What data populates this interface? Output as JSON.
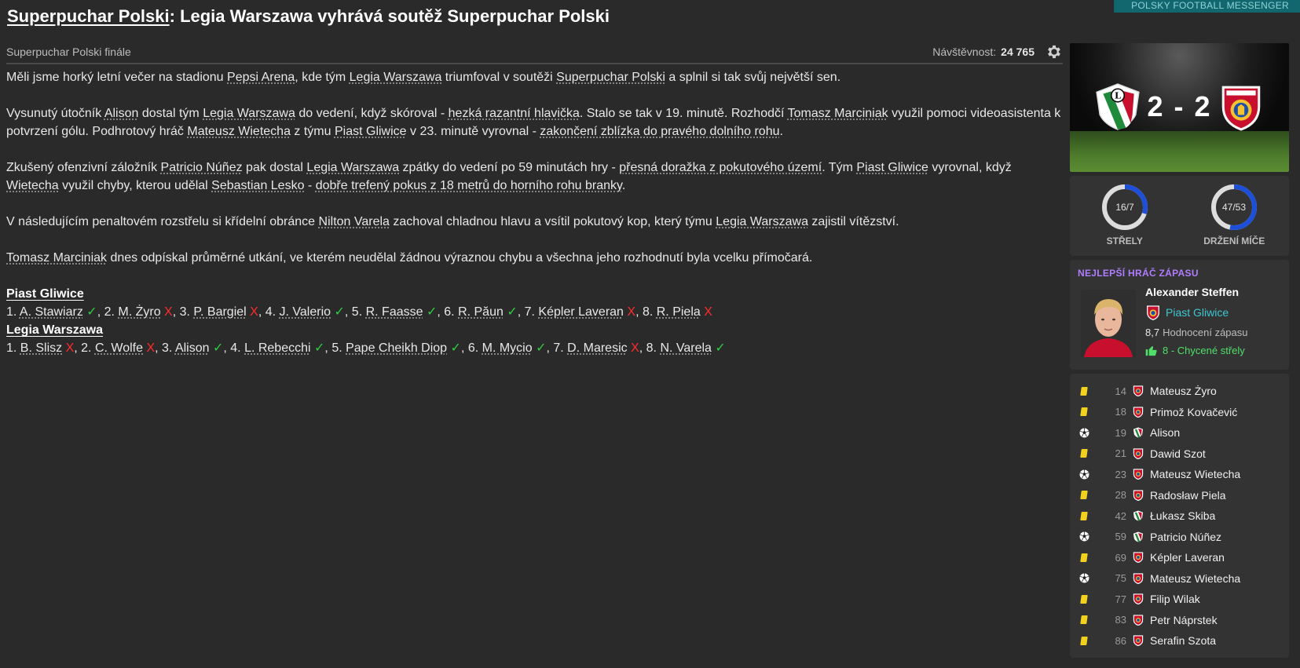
{
  "brand": "POLSKY FOOTBALL MESSENGER",
  "header": {
    "competition": "Superpuchar Polski",
    "headline": ": Legia Warszawa vyhrává soutěž Superpuchar Polski"
  },
  "subheader": {
    "stage": "Superpuchar Polski finále",
    "attendance_label": "Návštěvnost:",
    "attendance_value": "24 765"
  },
  "article": {
    "p1": [
      {
        "t": "Měli jsme horký letní večer na stadionu "
      },
      {
        "t": "Pepsi Arena",
        "u": true
      },
      {
        "t": ", kde tým "
      },
      {
        "t": "Legia Warszawa",
        "u": true
      },
      {
        "t": " triumfoval v soutěži "
      },
      {
        "t": "Superpuchar Polski",
        "u": true
      },
      {
        "t": " a splnil si tak svůj největší sen."
      }
    ],
    "p2": [
      {
        "t": "Vysunutý útočník "
      },
      {
        "t": "Alison",
        "u": true
      },
      {
        "t": " dostal tým "
      },
      {
        "t": "Legia Warszawa",
        "u": true
      },
      {
        "t": " do vedení, když skóroval - "
      },
      {
        "t": "hezká razantní hlavička",
        "u": true
      },
      {
        "t": ". Stalo se tak v 19. minutě. Rozhodčí "
      },
      {
        "t": "Tomasz Marciniak",
        "u": true
      },
      {
        "t": " využil pomoci videoasistenta k potvrzení gólu. Podhrotový hráč "
      },
      {
        "t": "Mateusz Wietecha",
        "u": true
      },
      {
        "t": " z týmu "
      },
      {
        "t": "Piast Gliwice",
        "u": true
      },
      {
        "t": " v 23. minutě vyrovnal - "
      },
      {
        "t": "zakončení zblízka do pravého dolního rohu",
        "u": true
      },
      {
        "t": "."
      }
    ],
    "p3": [
      {
        "t": "Zkušený ofenzivní záložník "
      },
      {
        "t": "Patricio Núñez",
        "u": true
      },
      {
        "t": " pak dostal "
      },
      {
        "t": "Legia Warszawa",
        "u": true
      },
      {
        "t": " zpátky do vedení po 59 minutách hry - "
      },
      {
        "t": "přesná doražka z pokutového území",
        "u": true
      },
      {
        "t": ". Tým "
      },
      {
        "t": "Piast Gliwice",
        "u": true
      },
      {
        "t": " vyrovnal, když "
      },
      {
        "t": "Wietecha",
        "u": true
      },
      {
        "t": " využil chyby, kterou udělal "
      },
      {
        "t": "Sebastian Lesko",
        "u": true
      },
      {
        "t": " - "
      },
      {
        "t": "dobře trefený pokus z 18 metrů do horního rohu branky",
        "u": true
      },
      {
        "t": "."
      }
    ],
    "p4": [
      {
        "t": "V následujícím penaltovém rozstřelu si křídelní obránce "
      },
      {
        "t": "Nilton Varela",
        "u": true
      },
      {
        "t": " zachoval chladnou hlavu a vsítil pokutový kop, který týmu "
      },
      {
        "t": "Legia Warszawa",
        "u": true
      },
      {
        "t": " zajistil vítězství."
      }
    ],
    "p5": [
      {
        "t": "Tomasz Marciniak",
        "u": true
      },
      {
        "t": " dnes odpískal průměrné utkání, ve kterém neudělal žádnou výraznou chybu a všechna jeho rozhodnutí byla vcelku přímočará."
      }
    ]
  },
  "penalties": [
    {
      "team": "Piast Gliwice",
      "kicks": [
        {
          "n": "1.",
          "name": "A. Stawiarz",
          "ok": true
        },
        {
          "n": "2.",
          "name": "M. Żyro",
          "ok": false
        },
        {
          "n": "3.",
          "name": "P. Bargiel",
          "ok": false
        },
        {
          "n": "4.",
          "name": "J. Valerio",
          "ok": true
        },
        {
          "n": "5.",
          "name": "R. Faasse",
          "ok": true
        },
        {
          "n": "6.",
          "name": "R. Păun",
          "ok": true
        },
        {
          "n": "7.",
          "name": "Képler Laveran",
          "ok": false
        },
        {
          "n": "8.",
          "name": "R. Piela",
          "ok": false
        }
      ]
    },
    {
      "team": "Legia Warszawa",
      "kicks": [
        {
          "n": "1.",
          "name": "B. Slisz",
          "ok": false
        },
        {
          "n": "2.",
          "name": "C. Wolfe",
          "ok": false
        },
        {
          "n": "3.",
          "name": "Alison",
          "ok": true
        },
        {
          "n": "4.",
          "name": "L. Rebecchi",
          "ok": true
        },
        {
          "n": "5.",
          "name": "Pape Cheikh Diop",
          "ok": true
        },
        {
          "n": "6.",
          "name": "M. Mycio",
          "ok": true
        },
        {
          "n": "7.",
          "name": "D. Maresic",
          "ok": false
        },
        {
          "n": "8.",
          "name": "N. Varela",
          "ok": true
        }
      ]
    }
  ],
  "marks": {
    "scored": "✓",
    "missed": "X"
  },
  "scorecard": {
    "score": "2 - 2"
  },
  "stats": [
    {
      "label": "STŘELY",
      "value": "16/7",
      "fraction": 0.3
    },
    {
      "label": "DRŽENÍ MÍČE",
      "value": "47/53",
      "fraction": 0.53
    }
  ],
  "colors": {
    "accent": "#1e4fd8",
    "ring_track": "#dddddd",
    "purple": "#b07dff",
    "teal": "#3ec7d0",
    "green": "#4fe06a"
  },
  "motm": {
    "heading": "NEJLEPŠÍ HRÁČ ZÁPASU",
    "name": "Alexander Steffen",
    "club": "Piast Gliwice",
    "rating_value": "8,7",
    "rating_label": "Hodnocení zápasu",
    "best_stat": "8 - Chycené střely"
  },
  "events": [
    {
      "icon": "yellow-card",
      "minute": "14",
      "team": "piast",
      "player": "Mateusz Żyro"
    },
    {
      "icon": "yellow-card",
      "minute": "18",
      "team": "piast",
      "player": "Primož Kovačević"
    },
    {
      "icon": "goal",
      "minute": "19",
      "team": "legia",
      "player": "Alison"
    },
    {
      "icon": "yellow-card",
      "minute": "21",
      "team": "piast",
      "player": "Dawid Szot"
    },
    {
      "icon": "goal",
      "minute": "23",
      "team": "piast",
      "player": "Mateusz Wietecha"
    },
    {
      "icon": "yellow-card",
      "minute": "28",
      "team": "piast",
      "player": "Radosław Piela"
    },
    {
      "icon": "yellow-card",
      "minute": "42",
      "team": "legia",
      "player": "Łukasz Skiba"
    },
    {
      "icon": "goal",
      "minute": "59",
      "team": "legia",
      "player": "Patricio Núñez"
    },
    {
      "icon": "yellow-card",
      "minute": "69",
      "team": "piast",
      "player": "Képler Laveran"
    },
    {
      "icon": "goal",
      "minute": "75",
      "team": "piast",
      "player": "Mateusz Wietecha"
    },
    {
      "icon": "yellow-card",
      "minute": "77",
      "team": "piast",
      "player": "Filip Wilak"
    },
    {
      "icon": "yellow-card",
      "minute": "83",
      "team": "piast",
      "player": "Petr Náprstek"
    },
    {
      "icon": "yellow-card",
      "minute": "86",
      "team": "piast",
      "player": "Serafin Szota"
    }
  ]
}
